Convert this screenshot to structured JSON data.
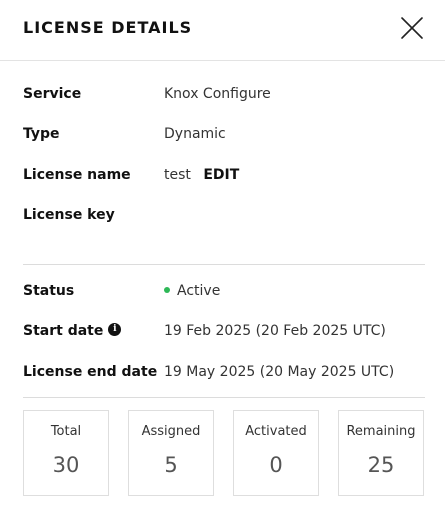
{
  "dialog": {
    "title": "LICENSE DETAILS"
  },
  "fields": {
    "service": {
      "label": "Service",
      "value": "Knox Configure"
    },
    "type": {
      "label": "Type",
      "value": "Dynamic"
    },
    "license_name": {
      "label": "License name",
      "value": "test",
      "edit_label": "EDIT"
    },
    "license_key": {
      "label": "License key",
      "value": ""
    },
    "status": {
      "label": "Status",
      "value": "Active",
      "status_color": "#2eb857"
    },
    "start_date": {
      "label": "Start date",
      "value": "19 Feb 2025 (20 Feb 2025 UTC)",
      "info_glyph": "i"
    },
    "end_date": {
      "label": "License end date",
      "value": "19 May 2025 (20 May 2025 UTC)"
    }
  },
  "stats": {
    "total": {
      "label": "Total",
      "value": "30"
    },
    "assigned": {
      "label": "Assigned",
      "value": "5"
    },
    "activated": {
      "label": "Activated",
      "value": "0"
    },
    "remaining": {
      "label": "Remaining",
      "value": "25"
    }
  },
  "icons": {
    "close": "close-icon",
    "info": "info-icon"
  }
}
